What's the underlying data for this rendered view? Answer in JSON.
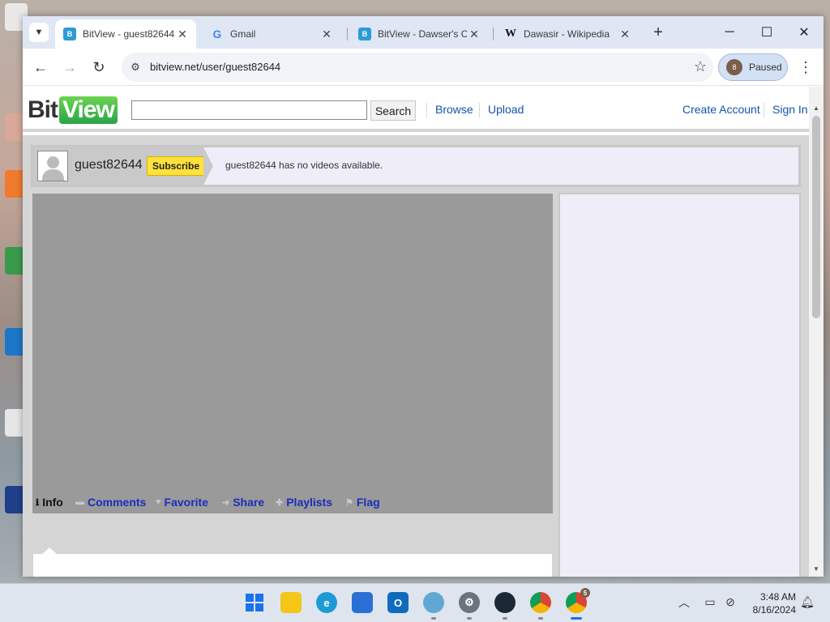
{
  "browser": {
    "tabs": [
      {
        "title": "BitView - guest82644",
        "favicon": "bitview-favicon",
        "active": true
      },
      {
        "title": "Gmail",
        "favicon": "google-favicon",
        "active": false
      },
      {
        "title": "BitView - Dawser's C",
        "favicon": "bitview-favicon",
        "active": false
      },
      {
        "title": "Dawasir - Wikipedia",
        "favicon": "wikipedia-favicon",
        "active": false
      }
    ],
    "url": "bitview.net/user/guest82644",
    "profile_label": "Paused",
    "profile_initial": "8"
  },
  "site": {
    "logo_bit": "Bit",
    "logo_view": "View",
    "search_button": "Search",
    "nav": {
      "browse": "Browse",
      "upload": "Upload",
      "create_account": "Create Account",
      "sign_in": "Sign In"
    }
  },
  "profile": {
    "username": "guest82644",
    "subscribe": "Subscribe",
    "message": "guest82644 has no videos available."
  },
  "player_tabs": [
    {
      "label": "Info",
      "icon": "info-icon"
    },
    {
      "label": "Comments",
      "icon": "comment-icon"
    },
    {
      "label": "Favorite",
      "icon": "heart-icon"
    },
    {
      "label": "Share",
      "icon": "share-icon"
    },
    {
      "label": "Playlists",
      "icon": "plus-icon"
    },
    {
      "label": "Flag",
      "icon": "flag-icon"
    }
  ],
  "taskbar": {
    "time": "3:48 AM",
    "date": "8/16/2024",
    "chrome_badge": "5"
  },
  "colors": {
    "link": "#1155aa",
    "subscribe_bg": "#ffe13a",
    "logo_green": "#2aa44a",
    "tab_strip": "#dfe7f5"
  }
}
